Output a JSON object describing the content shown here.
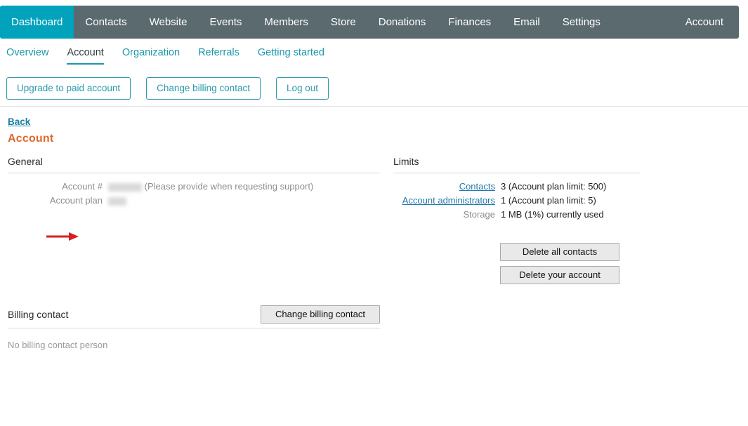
{
  "topnav": {
    "items": [
      {
        "label": "Dashboard",
        "active": true
      },
      {
        "label": "Contacts",
        "active": false
      },
      {
        "label": "Website",
        "active": false
      },
      {
        "label": "Events",
        "active": false
      },
      {
        "label": "Members",
        "active": false
      },
      {
        "label": "Store",
        "active": false
      },
      {
        "label": "Donations",
        "active": false
      },
      {
        "label": "Finances",
        "active": false
      },
      {
        "label": "Email",
        "active": false
      },
      {
        "label": "Settings",
        "active": false
      }
    ],
    "account_label": "Account"
  },
  "subnav": {
    "items": [
      {
        "label": "Overview",
        "active": false
      },
      {
        "label": "Account",
        "active": true
      },
      {
        "label": "Organization",
        "active": false
      },
      {
        "label": "Referrals",
        "active": false
      },
      {
        "label": "Getting started",
        "active": false
      }
    ]
  },
  "actions": {
    "upgrade": "Upgrade to paid account",
    "change_billing": "Change billing contact",
    "logout": "Log out"
  },
  "page": {
    "back": "Back",
    "title": "Account"
  },
  "general": {
    "heading": "General",
    "rows": [
      {
        "label": "Account #",
        "value": "",
        "redacted": true,
        "hint": "(Please provide when requesting support)"
      },
      {
        "label": "Account plan",
        "value": "",
        "redacted": true,
        "hint": ""
      }
    ]
  },
  "limits": {
    "heading": "Limits",
    "rows": [
      {
        "label": "Contacts",
        "is_link": true,
        "value": "3 (Account plan limit: 500)"
      },
      {
        "label": "Account administrators",
        "is_link": true,
        "value": "1 (Account plan limit: 5)"
      },
      {
        "label": "Storage",
        "is_link": false,
        "value": "1 MB (1%) currently used"
      }
    ],
    "delete_all_contacts": "Delete all contacts",
    "delete_your_account": "Delete your account"
  },
  "billing": {
    "heading": "Billing contact",
    "change_button": "Change billing contact",
    "empty_note": "No billing contact person"
  },
  "annotation": {
    "arrow_color": "#d81f1f",
    "target": "Account #"
  },
  "colors": {
    "nav_bar": "#5b6a6f",
    "nav_active": "#00a3bb",
    "teal": "#1a97ac",
    "title_orange": "#dd6a2b",
    "link_blue": "#2277aa",
    "arrow_red": "#d81f1f"
  }
}
